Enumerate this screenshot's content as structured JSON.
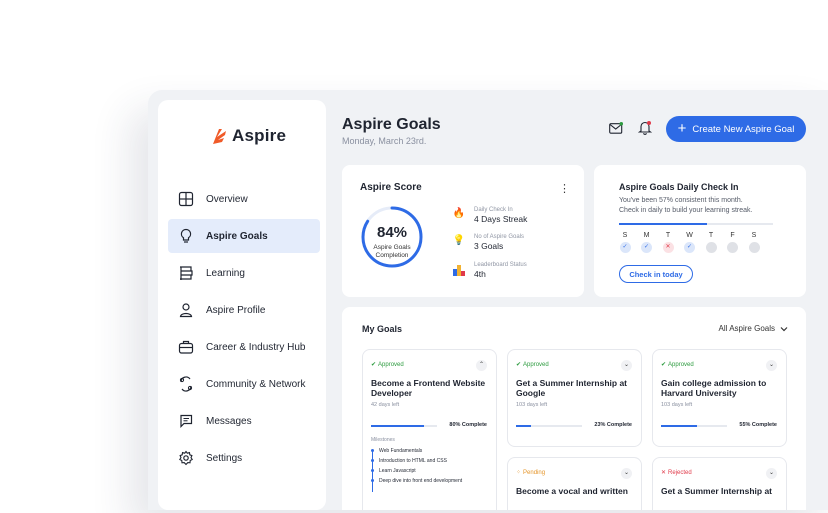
{
  "brand": {
    "name": "Aspire"
  },
  "sidebar": {
    "items": [
      {
        "label": "Overview",
        "icon": "overview-icon",
        "active": false
      },
      {
        "label": "Aspire Goals",
        "icon": "lightbulb-icon",
        "active": true
      },
      {
        "label": "Learning",
        "icon": "learning-icon",
        "active": false
      },
      {
        "label": "Aspire Profile",
        "icon": "user-icon",
        "active": false
      },
      {
        "label": "Career & Industry Hub",
        "icon": "briefcase-icon",
        "active": false
      },
      {
        "label": "Community & Network",
        "icon": "community-icon",
        "active": false
      },
      {
        "label": "Messages",
        "icon": "chat-icon",
        "active": false
      },
      {
        "label": "Settings",
        "icon": "gear-icon",
        "active": false
      }
    ]
  },
  "header": {
    "title": "Aspire Goals",
    "date": "Monday, March 23rd.",
    "create_label": "Create New Aspire Goal"
  },
  "score": {
    "title": "Aspire Score",
    "percent": "84%",
    "percent_value": 84,
    "gauge_label_1": "Aspire Goals",
    "gauge_label_2": "Completion",
    "stats": [
      {
        "label": "Daily Check In",
        "value": "4 Days Streak",
        "icon": "flame-icon"
      },
      {
        "label": "No of Aspire Goals",
        "value": "3 Goals",
        "icon": "bulb-icon"
      },
      {
        "label": "Leaderboard Status",
        "value": "4th",
        "icon": "podium-icon"
      }
    ]
  },
  "checkin": {
    "title": "Aspire Goals Daily Check In",
    "line1": "You've been 57% consistent this month.",
    "line2": "Check in daily to build your learning streak.",
    "consistency": 0.57,
    "days": [
      {
        "letter": "S",
        "state": "done"
      },
      {
        "letter": "M",
        "state": "done"
      },
      {
        "letter": "T",
        "state": "missed"
      },
      {
        "letter": "W",
        "state": "done"
      },
      {
        "letter": "T",
        "state": "none"
      },
      {
        "letter": "F",
        "state": "none"
      },
      {
        "letter": "S",
        "state": "none"
      }
    ],
    "button_label": "Check in today"
  },
  "goals": {
    "title": "My Goals",
    "filter_label": "All Aspire Goals",
    "milestones_label": "Milestones",
    "items": [
      {
        "status": "Approved",
        "title_1": "Become a Frontend Website",
        "title_2": "Developer",
        "days_left": "42 days left",
        "progress": 0.8,
        "progress_label": "80% Complete",
        "expanded": true,
        "milestones": [
          "Web Fundamentals",
          "Introduction to HTML and CSS",
          "Learn Javascript",
          "Deep dive into front end development"
        ]
      },
      {
        "status": "Approved",
        "title_1": "Get a Summer Internship at",
        "title_2": "Google",
        "days_left": "103 days left",
        "progress": 0.23,
        "progress_label": "23% Complete"
      },
      {
        "status": "Approved",
        "title_1": "Gain college admission to",
        "title_2": "Harvard University",
        "days_left": "103 days left",
        "progress": 0.55,
        "progress_label": "55% Complete"
      },
      {
        "status": "Pending",
        "title_1": "Become a vocal and written"
      },
      {
        "status": "Rejected",
        "title_1": "Get a Summer Internship at"
      }
    ]
  },
  "colors": {
    "accent": "#2e6be6",
    "approved": "#2d9b3f",
    "pending": "#e5952a",
    "rejected": "#e03a4a",
    "logo": "#f05a28"
  }
}
